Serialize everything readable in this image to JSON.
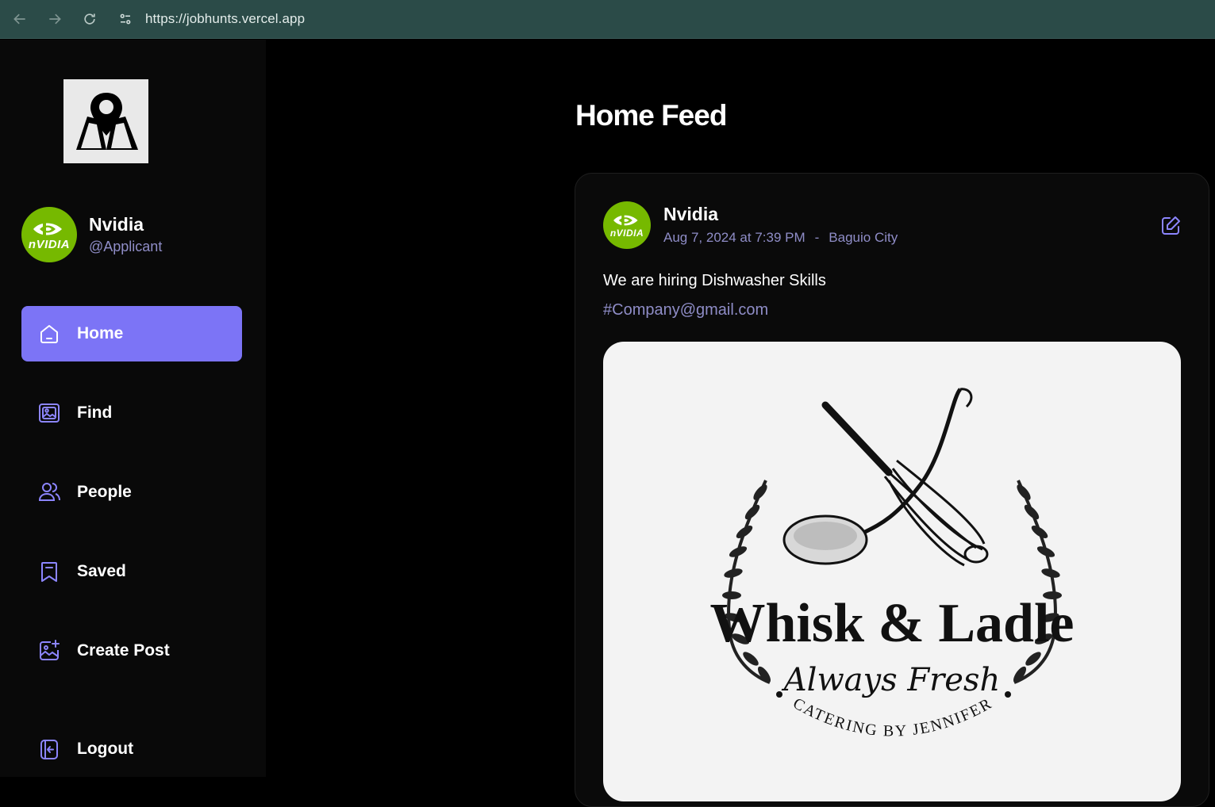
{
  "browser": {
    "url": "https://jobhunts.vercel.app"
  },
  "sidebar": {
    "profile": {
      "name": "Nvidia",
      "handle": "@Applicant",
      "avatar_text": "nVIDIA"
    },
    "items": [
      {
        "label": "Home",
        "icon": "home-icon",
        "active": true
      },
      {
        "label": "Find",
        "icon": "gallery-icon",
        "active": false
      },
      {
        "label": "People",
        "icon": "people-icon",
        "active": false
      },
      {
        "label": "Saved",
        "icon": "bookmark-icon",
        "active": false
      },
      {
        "label": "Create Post",
        "icon": "image-plus-icon",
        "active": false
      },
      {
        "label": "Logout",
        "icon": "logout-icon",
        "active": false
      }
    ]
  },
  "main": {
    "title": "Home Feed",
    "post": {
      "author": "Nvidia",
      "avatar_text": "nVIDIA",
      "date": "Aug 7, 2024 at 7:39 PM",
      "separator": "-",
      "location": "Baguio City",
      "text": "We are hiring Dishwasher Skills",
      "tag": "#Company@gmail.com",
      "image": {
        "brand": "Whisk & Ladle",
        "tagline": "Always Fresh",
        "subtitle": "CATERING BY JENNIFER"
      }
    }
  },
  "colors": {
    "accent": "#7c74f6",
    "icon_accent": "#8c85ff",
    "muted_text": "#8f8dc7",
    "nvidia_green": "#76b900"
  }
}
